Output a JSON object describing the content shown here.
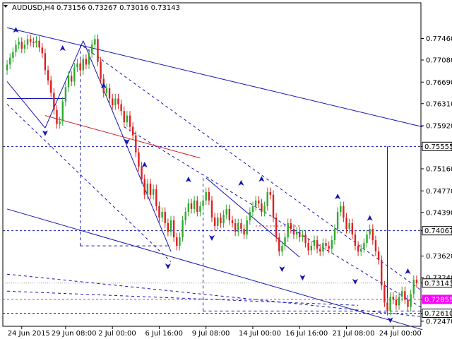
{
  "header": {
    "symbol": "AUDUSD,H4",
    "ohlc": "0.73156 0.73267 0.73016 0.73143"
  },
  "colors": {
    "bull": "#2eaa2e",
    "bear": "#dd2020",
    "trend": "#1414b4",
    "red_line": "#cc2020",
    "magenta": "#ff00ff",
    "current_price_bg": "#ffffff"
  },
  "chart_data": {
    "type": "candlestick",
    "ylim": [
      0.7238,
      0.7794
    ],
    "y_ticks": [
      "0.77460",
      "0.77080",
      "0.76690",
      "0.76310",
      "0.75920",
      "0.75555",
      "0.75160",
      "0.74770",
      "0.74390",
      "0.74067",
      "0.73620",
      "0.73240",
      "0.73143",
      "0.72855",
      "0.72610",
      "0.72470"
    ],
    "y_tick_values": [
      0.7746,
      0.7708,
      0.7669,
      0.7631,
      0.7592,
      0.75555,
      0.7516,
      0.7477,
      0.7439,
      0.74067,
      0.7362,
      0.7324,
      0.73143,
      0.72855,
      0.7261,
      0.7247
    ],
    "boxed_levels": [
      {
        "label": "0.75555",
        "value": 0.75555,
        "style": "black"
      },
      {
        "label": "0.74067",
        "value": 0.74067,
        "style": "black"
      },
      {
        "label": "0.73143",
        "value": 0.73143,
        "style": "current"
      },
      {
        "label": "0.72855",
        "value": 0.72855,
        "style": "magenta"
      },
      {
        "label": "0.72610",
        "value": 0.7261,
        "style": "black"
      }
    ],
    "x_ticks": [
      {
        "label": "24 Jun 2015",
        "bar": 5
      },
      {
        "label": "29 Jun 08:00",
        "bar": 20
      },
      {
        "label": "2 Jul 00:00",
        "bar": 36
      },
      {
        "label": "6 Jul 16:00",
        "bar": 52
      },
      {
        "label": "9 Jul 08:00",
        "bar": 68
      },
      {
        "label": "14 Jul 00:00",
        "bar": 84
      },
      {
        "label": "16 Jul 16:00",
        "bar": 100
      },
      {
        "label": "21 Jul 08:00",
        "bar": 116
      },
      {
        "label": "24 Jul 00:00",
        "bar": 132
      }
    ],
    "closes": [
      0.77,
      0.7712,
      0.7722,
      0.7735,
      0.774,
      0.7728,
      0.7735,
      0.7745,
      0.774,
      0.7738,
      0.7742,
      0.773,
      0.772,
      0.769,
      0.7672,
      0.765,
      0.762,
      0.7595,
      0.76,
      0.7635,
      0.766,
      0.768,
      0.767,
      0.7695,
      0.7702,
      0.769,
      0.771,
      0.77,
      0.772,
      0.7735,
      0.7745,
      0.7705,
      0.7675,
      0.765,
      0.7658,
      0.764,
      0.7628,
      0.764,
      0.763,
      0.7618,
      0.7598,
      0.761,
      0.759,
      0.7575,
      0.7545,
      0.752,
      0.7498,
      0.747,
      0.749,
      0.747,
      0.748,
      0.745,
      0.743,
      0.744,
      0.742,
      0.7405,
      0.7425,
      0.7395,
      0.738,
      0.7395,
      0.7425,
      0.744,
      0.7455,
      0.7445,
      0.746,
      0.744,
      0.745,
      0.746,
      0.7475,
      0.746,
      0.743,
      0.7415,
      0.743,
      0.742,
      0.7435,
      0.7445,
      0.7425,
      0.742,
      0.7405,
      0.742,
      0.741,
      0.74,
      0.7425,
      0.744,
      0.745,
      0.746,
      0.7455,
      0.744,
      0.745,
      0.7475,
      0.747,
      0.743,
      0.7395,
      0.737,
      0.738,
      0.7395,
      0.742,
      0.741,
      0.74,
      0.7405,
      0.7395,
      0.74,
      0.7385,
      0.7372,
      0.738,
      0.739,
      0.7375,
      0.737,
      0.7385,
      0.738,
      0.7375,
      0.739,
      0.741,
      0.744,
      0.745,
      0.743,
      0.741,
      0.742,
      0.74,
      0.738,
      0.737,
      0.7375,
      0.7385,
      0.74,
      0.741,
      0.739,
      0.737,
      0.7355,
      0.731,
      0.728,
      0.7265,
      0.729,
      0.7285,
      0.7275,
      0.729,
      0.73,
      0.7285,
      0.7272,
      0.7295,
      0.732,
      0.7314
    ]
  }
}
